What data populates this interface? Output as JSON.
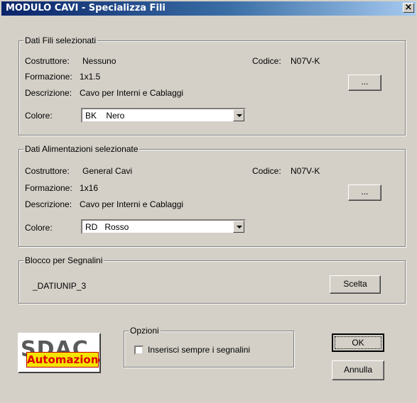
{
  "window": {
    "title": "MODULO CAVI - Specializza Fili",
    "close": "×"
  },
  "fili": {
    "legend": "Dati Fili selezionati",
    "costruttore_label": "Costruttore:",
    "costruttore_value": "Nessuno",
    "formazione_label": "Formazione:",
    "formazione_value": "1x1.5",
    "descrizione_label": "Descrizione:",
    "descrizione_value": "Cavo per Interni e Cablaggi",
    "codice_label": "Codice:",
    "codice_value": "N07V-K",
    "browse": "...",
    "colore_label": "Colore:",
    "colore_value": "BK    Nero"
  },
  "alimentazioni": {
    "legend": "Dati Alimentazioni selezionate",
    "costruttore_label": "Costruttore:",
    "costruttore_value": "General Cavi",
    "formazione_label": "Formazione:",
    "formazione_value": "1x16",
    "descrizione_label": "Descrizione:",
    "descrizione_value": "Cavo per Interni e Cablaggi",
    "codice_label": "Codice:",
    "codice_value": "N07V-K",
    "browse": "...",
    "colore_label": "Colore:",
    "colore_value": "RD   Rosso"
  },
  "blocco": {
    "legend": "Blocco per Segnalini",
    "value": "_DATIUNIP_3",
    "button": "Scelta"
  },
  "logo": {
    "back": "SDAC",
    "front": "Automazione"
  },
  "opzioni": {
    "legend": "Opzioni",
    "checkbox_label": "Inserisci sempre i segnalini",
    "checked": false
  },
  "buttons": {
    "ok": "OK",
    "annulla": "Annulla"
  }
}
